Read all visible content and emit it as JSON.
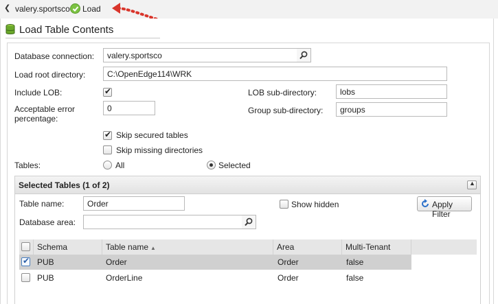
{
  "breadcrumb": {
    "connection": "valery.sportsco",
    "current": "Load"
  },
  "page": {
    "title": "Load Table Contents"
  },
  "form": {
    "database_connection": {
      "label": "Database connection:",
      "value": "valery.sportsco"
    },
    "load_root_directory": {
      "label": "Load root directory:",
      "value": "C:\\OpenEdge114\\WRK"
    },
    "include_lob": {
      "label": "Include LOB:",
      "checked": true
    },
    "lob_subdirectory": {
      "label": "LOB sub-directory:",
      "value": "lobs"
    },
    "acceptable_error": {
      "label_line1": "Acceptable error",
      "label_line2": "percentage:",
      "value": "0"
    },
    "group_subdirectory": {
      "label": "Group sub-directory:",
      "value": "groups"
    },
    "skip_secured": {
      "label": "Skip secured tables",
      "checked": true
    },
    "skip_missing": {
      "label": "Skip missing directories",
      "checked": false
    },
    "tables": {
      "label": "Tables:",
      "options": [
        "All",
        "Selected"
      ],
      "selected": "Selected"
    }
  },
  "selected_tables": {
    "title": "Selected Tables (1 of 2)",
    "table_name": {
      "label": "Table name:",
      "value": "Order"
    },
    "database_area": {
      "label": "Database area:",
      "value": ""
    },
    "show_hidden": {
      "label": "Show hidden",
      "checked": false
    },
    "apply_filter_label": "Apply Filter",
    "columns": [
      "Schema",
      "Table name",
      "Area",
      "Multi-Tenant"
    ],
    "rows": [
      {
        "schema": "PUB",
        "table": "Order",
        "area": "Order",
        "multi_tenant": "false",
        "checked": true
      },
      {
        "schema": "PUB",
        "table": "OrderLine",
        "area": "Order",
        "multi_tenant": "false",
        "checked": false
      }
    ]
  },
  "colors": {
    "load_icon": "#7cc242",
    "callout_arrow": "#d9352b",
    "selected_row": "#d0d0d0"
  },
  "icons": {
    "back": "chevron-left-icon",
    "load": "check-circle-icon",
    "title": "database-icon",
    "lookup": "search-icon",
    "apply": "refresh-icon",
    "collapse": "collapse-up-icon"
  }
}
